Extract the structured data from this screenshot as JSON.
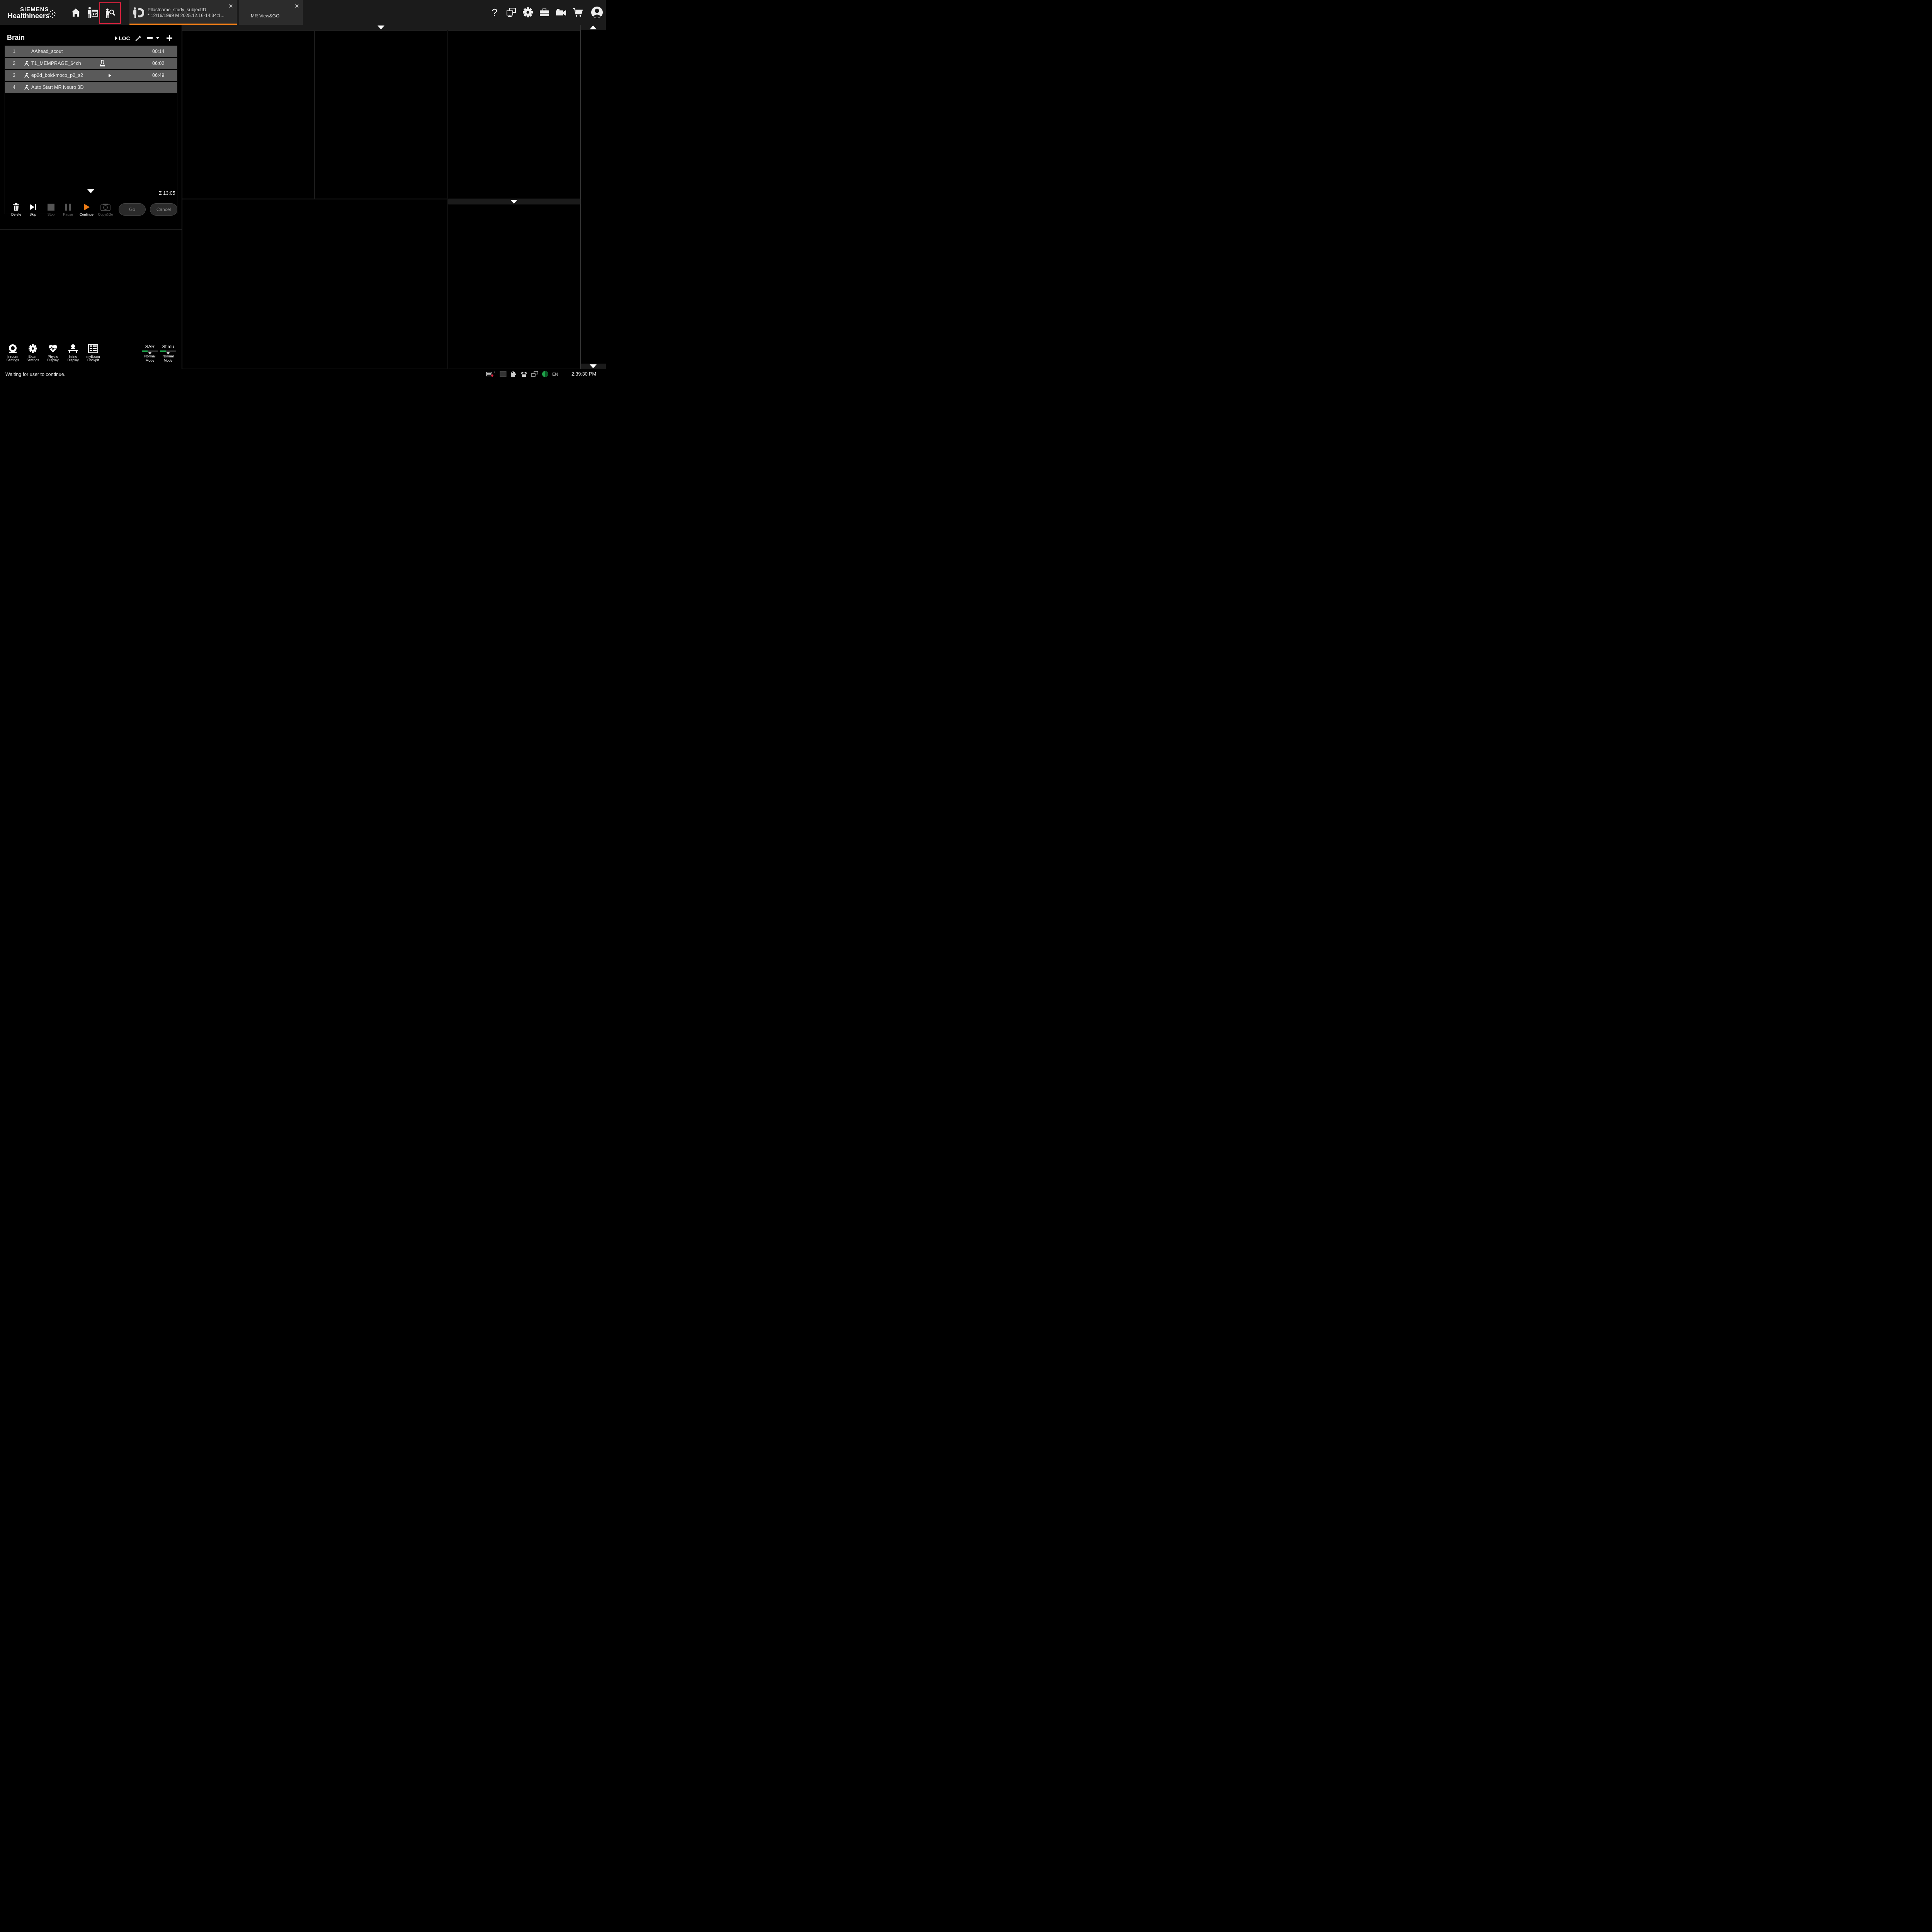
{
  "brand": {
    "line1": "SIEMENS",
    "line2": "Healthineers"
  },
  "tabs": [
    {
      "title": "Pllastname_study_subjectID",
      "subtitle": "* 12/16/1999 M 2025.12.16-14:34:1..."
    },
    {
      "title": "MR View&GO"
    }
  ],
  "program": {
    "title": "Brain",
    "loc_label": "LOC"
  },
  "protocols": [
    {
      "index": "1",
      "name": "AAhead_scout",
      "time": "00:14"
    },
    {
      "index": "2",
      "name": "T1_MEMPRAGE_64ch",
      "time": "06:02"
    },
    {
      "index": "3",
      "name": "ep2d_bold-moco_p2_s2",
      "time": "06:49"
    },
    {
      "index": "4",
      "name": "Auto Start MR Neuro 3D",
      "time": ""
    }
  ],
  "total_time": "Σ 13:05",
  "controls": {
    "delete": "Delete",
    "skip": "Skip",
    "stop": "Stop",
    "pause": "Pause",
    "continue": "Continue",
    "copygo": "Copy&Go",
    "go": "Go",
    "cancel": "Cancel"
  },
  "bottom_tools": {
    "inroom": [
      "Inroom",
      "Settings"
    ],
    "exam": [
      "Exam",
      "Settings"
    ],
    "physio": [
      "Physio",
      "Display"
    ],
    "inline": [
      "Inline",
      "Display"
    ],
    "myexam": [
      "myExam",
      "Cockpit"
    ]
  },
  "sar": {
    "label": "SAR",
    "mode": [
      "Normal",
      "Mode"
    ]
  },
  "stimu": {
    "label": "Stimu",
    "mode": [
      "Normal",
      "Mode"
    ]
  },
  "status": {
    "message": "Waiting for user to continue.",
    "language": "EN",
    "clock": "2:39:30 PM"
  },
  "colors": {
    "accent": "#f07d16",
    "highlight_box": "#d0213c",
    "indicator_green": "#1fa34a"
  }
}
